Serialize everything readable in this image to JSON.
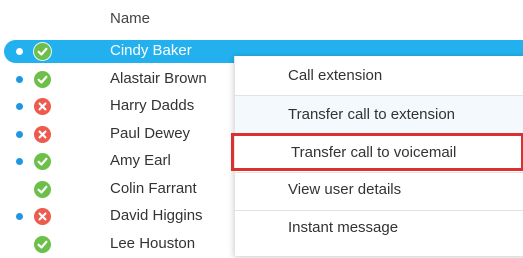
{
  "header": {
    "name_label": "Name"
  },
  "rows": [
    {
      "name": "Cindy Baker",
      "status": "available",
      "has_dot": true,
      "selected": true
    },
    {
      "name": "Alastair Brown",
      "status": "available",
      "has_dot": true
    },
    {
      "name": "Harry Dadds",
      "status": "busy",
      "has_dot": true
    },
    {
      "name": "Paul Dewey",
      "status": "busy",
      "has_dot": true
    },
    {
      "name": "Amy Earl",
      "status": "available",
      "has_dot": true
    },
    {
      "name": "Colin Farrant",
      "status": "available",
      "has_dot": false
    },
    {
      "name": "David Higgins",
      "status": "busy",
      "has_dot": true
    },
    {
      "name": "Lee Houston",
      "status": "available",
      "has_dot": false
    }
  ],
  "context_menu": {
    "items": [
      {
        "label": "Call extension"
      },
      {
        "label": "Transfer call to extension"
      },
      {
        "label": "Transfer call to voicemail"
      },
      {
        "label": "View user details"
      },
      {
        "label": "Instant message"
      }
    ]
  },
  "colors": {
    "selected_row": "#22b1ee",
    "presence_dot": "#1e96e2",
    "status_available": "#6cc04a",
    "status_busy": "#ec5b4d",
    "highlight_border": "#d9312f"
  },
  "icons": {
    "available": "check-circle-icon",
    "busy": "x-circle-icon",
    "presence": "presence-dot-icon"
  }
}
